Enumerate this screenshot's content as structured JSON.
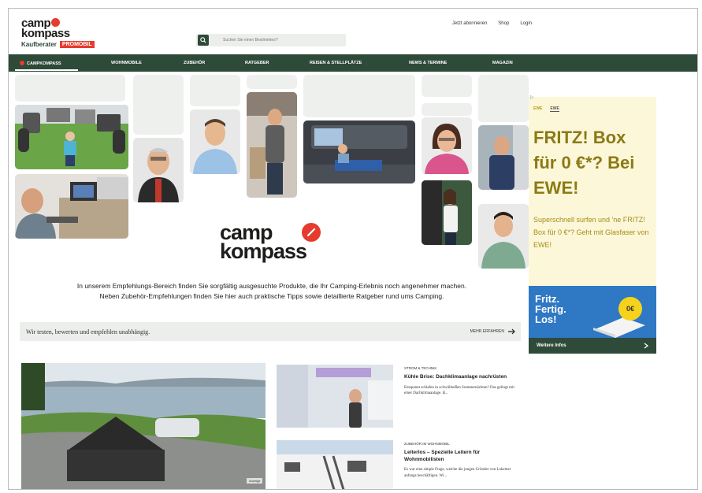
{
  "header": {
    "logo_line1": "camp",
    "logo_line2": "kompass",
    "logo_sub": "Kaufberater",
    "logo_badge": "PROMOBIL",
    "search_placeholder": "Suchen Sie einen Bestimmtes?",
    "toplinks": [
      "Jetzt abonnieren",
      "Shop",
      "Login"
    ]
  },
  "nav": {
    "items": [
      "Campkompass",
      "Wohnmobile",
      "Zubehör",
      "Ratgeber",
      "Reisen & Stellplätze",
      "News & Termine",
      "Magazin"
    ]
  },
  "hero": {
    "brand_line1": "camp",
    "brand_line2": "kompass"
  },
  "intro": {
    "line1": "In unserem Empfehlungs-Bereich finden Sie sorgfältig ausgesuchte Produkte, die Ihr Camping-Erlebnis noch angenehmer machen.",
    "line2": "Neben Zubehör-Empfehlungen finden Sie hier auch praktische Tipps sowie detaillierte Ratgeber rund ums Camping."
  },
  "testbar": {
    "text": "Wir testen, bewerten und empfehlen unabhängig.",
    "more": "Mehr erfahren"
  },
  "articles": [
    {
      "category": "Strom & Technik",
      "title": "Kühle Brise: Dachklimaanlage nachrüsten",
      "desc": "Entspannt schlafen in schwülheißen Sommernächten? Das gelingt mit einer Dachklimaanlage. B..."
    },
    {
      "category": "Zubehör im Wohnmobil",
      "title": "Leiterlos – Spezielle Leitern für Wohnmobilisten",
      "desc": "Es war eine simple Frage, welche die jungen Gründer von Lokemer anfangs beschäftigen. Wi..."
    }
  ],
  "feature": {
    "badge": "Anzeige"
  },
  "ad": {
    "tab1": "EWE",
    "tab2": "EWE",
    "headline": "FRITZ! Box für 0 €*? Bei EWE!",
    "copy": "Superschnell surfen und 'ne FRITZ! Box für 0 €*? Geht mit Glasfaser von EWE!",
    "promo_text": "Fritz. Fertig. Los!",
    "promo_coin": "0€",
    "cta": "Weitere Infos"
  },
  "colors": {
    "brand_green": "#2e4a38",
    "brand_red": "#e53c2e",
    "ad_bg": "#fcf7d9",
    "ad_text": "#8b7a15"
  }
}
